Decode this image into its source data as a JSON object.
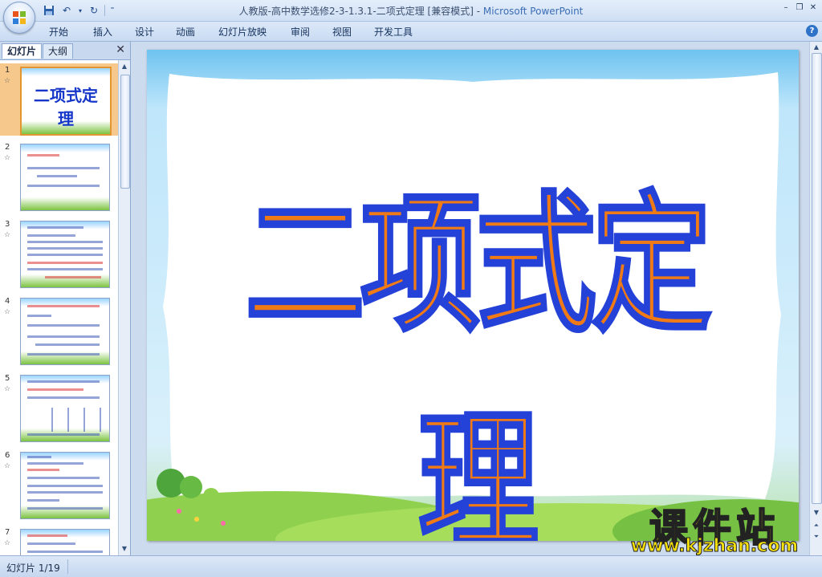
{
  "window": {
    "title_doc": "人教版-高中数学选修2-3-1.3.1-二项式定理 [兼容模式] - ",
    "title_app": "Microsoft PowerPoint",
    "controls": [
      "–",
      "❐",
      "✕"
    ]
  },
  "quick_access": {
    "save_icon": "save-icon",
    "undo_icon": "undo-icon",
    "redo_icon": "redo-icon"
  },
  "ribbon_tabs": [
    "开始",
    "插入",
    "设计",
    "动画",
    "幻灯片放映",
    "审阅",
    "视图",
    "开发工具"
  ],
  "help_label": "?",
  "pane": {
    "tab_slides": "幻灯片",
    "tab_outline": "大纲",
    "close": "✕",
    "slides": [
      {
        "num": "1",
        "star": "☆",
        "title": "二项式定理",
        "selected": true
      },
      {
        "num": "2",
        "star": "☆"
      },
      {
        "num": "3",
        "star": "☆"
      },
      {
        "num": "4",
        "star": "☆"
      },
      {
        "num": "5",
        "star": "☆"
      },
      {
        "num": "6",
        "star": "☆"
      },
      {
        "num": "7",
        "star": "☆"
      }
    ]
  },
  "slide": {
    "title": "二项式定理"
  },
  "watermark": {
    "cn": "课件站",
    "url": "www.kjzhan.com"
  },
  "status": {
    "slide_count": "幻灯片 1/19"
  }
}
